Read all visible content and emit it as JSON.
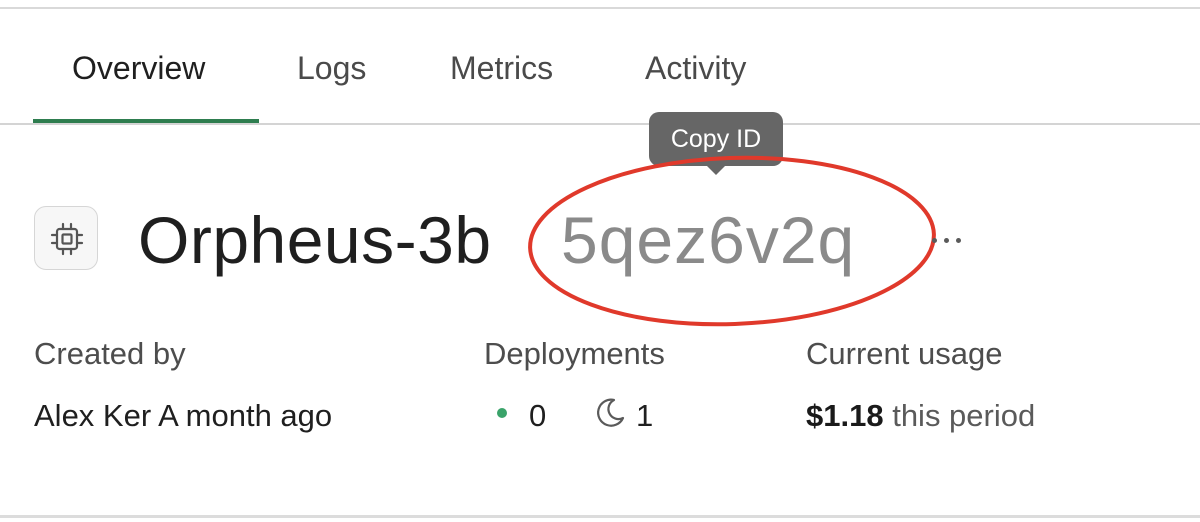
{
  "tabs": [
    {
      "label": "Overview",
      "active": true
    },
    {
      "label": "Logs",
      "active": false
    },
    {
      "label": "Metrics",
      "active": false
    },
    {
      "label": "Activity",
      "active": false
    }
  ],
  "tooltip": {
    "text": "Copy ID"
  },
  "resource": {
    "icon": "chip-icon",
    "name": "Orpheus-3b",
    "id": "5qez6v2q",
    "more_icon": "more-horizontal-icon"
  },
  "details": {
    "created_by": {
      "label": "Created by",
      "user": "Alex Ker",
      "time": "A month ago"
    },
    "deployments": {
      "label": "Deployments",
      "active_count": "0",
      "sleeping_count": "1",
      "active_icon": "green-dot-icon",
      "sleeping_icon": "moon-icon"
    },
    "usage": {
      "label": "Current usage",
      "amount": "$1.18",
      "period": "this period"
    }
  },
  "colors": {
    "accent": "#2e7d4f",
    "annotation": "#e0392b",
    "tooltip_bg": "#666666",
    "status_active": "#3aa36a"
  }
}
